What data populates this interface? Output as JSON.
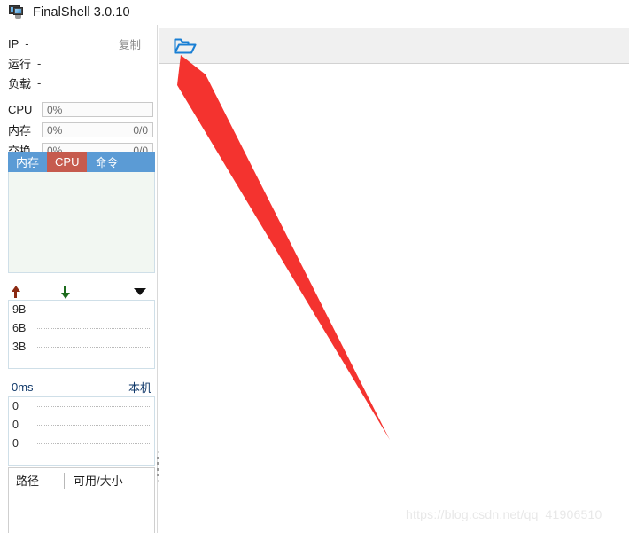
{
  "window": {
    "title": "FinalShell 3.0.10",
    "app_icon": "monitor-icon"
  },
  "sidebar": {
    "info_rows": [
      {
        "label": "IP",
        "value": "-",
        "action": "复制"
      },
      {
        "label": "运行",
        "value": "-"
      },
      {
        "label": "负载",
        "value": "-"
      }
    ],
    "metrics": [
      {
        "label": "CPU",
        "percent": "0%",
        "fraction": ""
      },
      {
        "label": "内存",
        "percent": "0%",
        "fraction": "0/0"
      },
      {
        "label": "交换",
        "percent": "0%",
        "fraction": "0/0"
      }
    ],
    "tabs": [
      {
        "label": "内存",
        "active": false
      },
      {
        "label": "CPU",
        "active": true
      },
      {
        "label": "命令",
        "active": false
      }
    ],
    "network_graph": {
      "upload_icon": "arrow-up-icon",
      "download_icon": "arrow-down-icon",
      "menu_icon": "caret-down-icon",
      "y_labels": [
        "9B",
        "6B",
        "3B"
      ]
    },
    "ping_graph": {
      "latency": "0ms",
      "host": "本机",
      "y_labels": [
        "0",
        "0",
        "0"
      ]
    },
    "disk_table": {
      "columns": [
        "路径",
        "可用/大小"
      ],
      "rows": []
    }
  },
  "toolbar": {
    "open_folder_label": "open-folder",
    "accent_color": "#1a7fd4"
  },
  "annotation": {
    "arrow_color": "#f4332f"
  },
  "watermark": {
    "text": "https://blog.csdn.net/qq_41906510"
  },
  "colors": {
    "tab_bar": "#5b9bd5",
    "tab_active": "#c65b4e",
    "panel_bg": "#f2f7f2",
    "toolbar_bg": "#f0f0f0"
  }
}
